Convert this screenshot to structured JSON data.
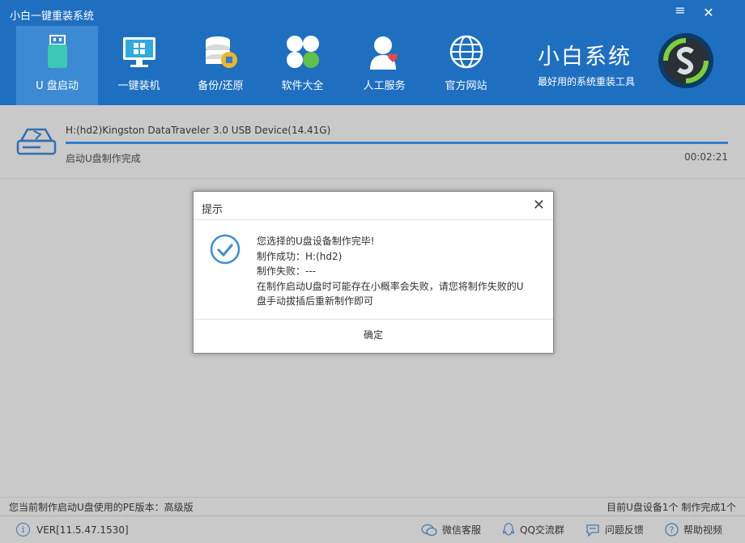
{
  "app": {
    "title": "小白一键重装系统"
  },
  "window_controls": {
    "minimize": "≡",
    "close": "✕"
  },
  "nav": [
    {
      "label": "U 盘启动",
      "icon": "usb-icon"
    },
    {
      "label": "一键装机",
      "icon": "windows-monitor-icon"
    },
    {
      "label": "备份/还原",
      "icon": "database-icon"
    },
    {
      "label": "软件大全",
      "icon": "apps-icon"
    },
    {
      "label": "人工服务",
      "icon": "user-heart-icon"
    },
    {
      "label": "官方网站",
      "icon": "globe-icon"
    }
  ],
  "brand": {
    "name": "小白系统",
    "slogan": "最好用的系统重装工具"
  },
  "device": {
    "name": "H:(hd2)Kingston DataTraveler 3.0 USB Device(14.41G)",
    "status": "启动U盘制作完成",
    "time": "00:02:21",
    "progress": 1.0
  },
  "dialog": {
    "title": "提示",
    "close": "✕",
    "lines": [
      "您选择的U盘设备制作完毕!",
      "制作成功：H:(hd2)",
      "制作失败：---",
      "在制作启动U盘时可能存在小概率会失败，请您将制作失败的U",
      "盘手动拔插后重新制作即可"
    ],
    "ok": "确定"
  },
  "statusbar": {
    "left": "您当前制作启动U盘使用的PE版本：高级版",
    "right": "目前U盘设备1个 制作完成1个"
  },
  "footer": {
    "version": "VER[11.5.47.1530]",
    "links": [
      {
        "label": "微信客服",
        "icon": "wechat-icon"
      },
      {
        "label": "QQ交流群",
        "icon": "qq-icon"
      },
      {
        "label": "问题反馈",
        "icon": "feedback-icon"
      },
      {
        "label": "帮助视频",
        "icon": "help-icon"
      }
    ]
  },
  "colors": {
    "header": "#1f6fc0",
    "active_tab": "#3d8ad4",
    "progress": "#2f7fd0",
    "check": "#3a8ed8"
  }
}
